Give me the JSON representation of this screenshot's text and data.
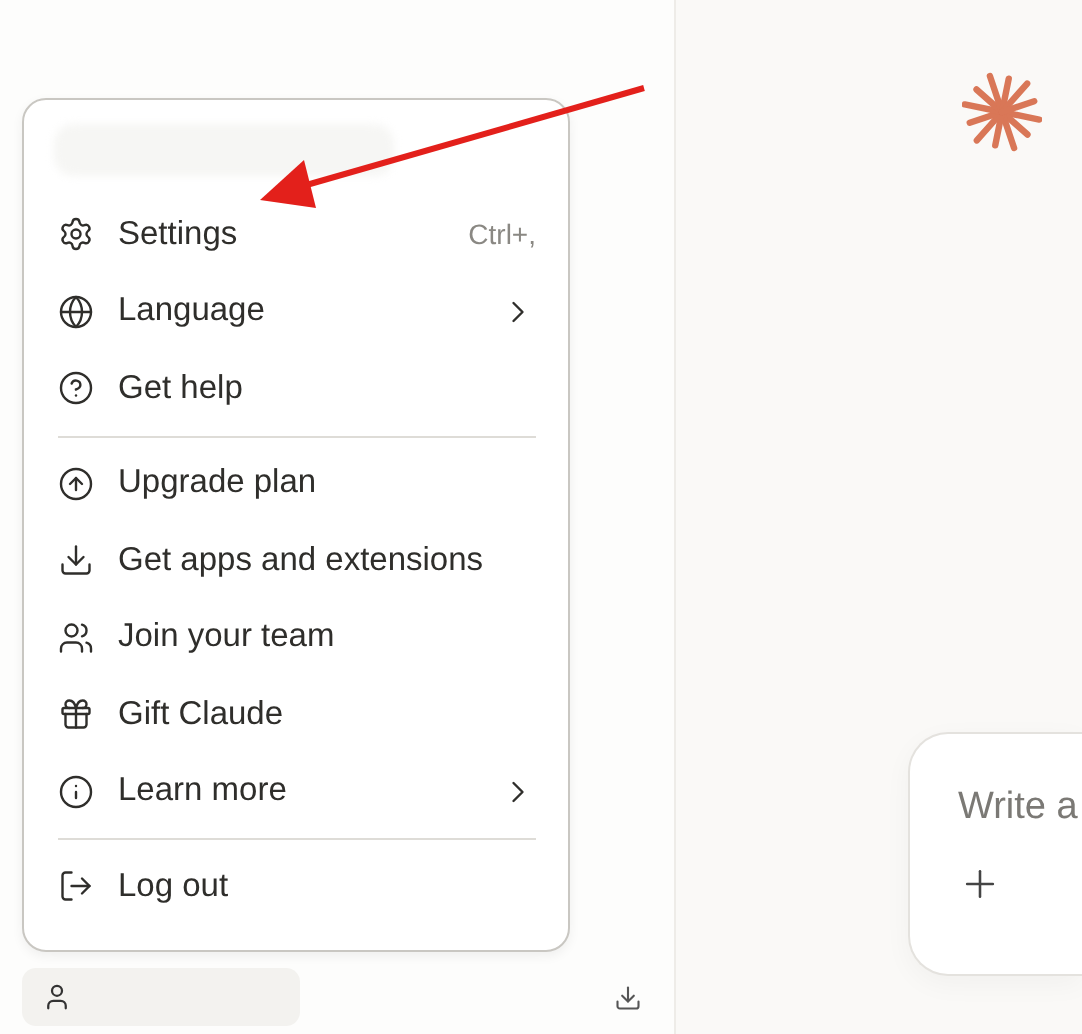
{
  "account_menu": {
    "items": [
      {
        "kind": "item",
        "label": "Settings",
        "shortcut": "Ctrl+,"
      },
      {
        "kind": "item",
        "label": "Language",
        "submenu": true
      },
      {
        "kind": "item",
        "label": "Get help"
      },
      {
        "kind": "divider"
      },
      {
        "kind": "item",
        "label": "Upgrade plan"
      },
      {
        "kind": "item",
        "label": "Get apps and extensions"
      },
      {
        "kind": "item",
        "label": "Join your team"
      },
      {
        "kind": "item",
        "label": "Gift Claude"
      },
      {
        "kind": "item",
        "label": "Learn more",
        "submenu": true
      },
      {
        "kind": "divider"
      },
      {
        "kind": "item",
        "label": "Log out"
      }
    ]
  },
  "composer": {
    "placeholder": "Write a"
  }
}
